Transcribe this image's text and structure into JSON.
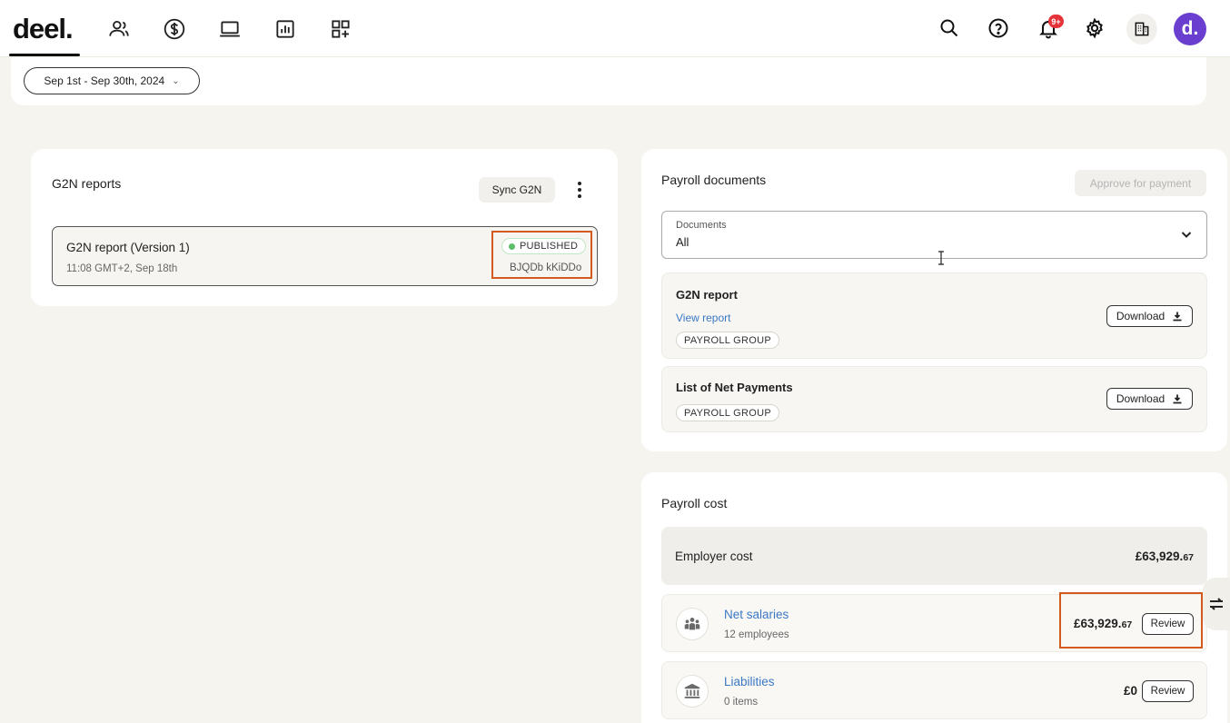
{
  "topbar": {
    "logo": "deel.",
    "nav_icons": [
      "people-icon",
      "dollar-icon",
      "laptop-icon",
      "chart-icon",
      "apps-add-icon"
    ],
    "notification_count": "9+",
    "avatar_initial": "d."
  },
  "filter": {
    "date_range": "Sep 1st - Sep 30th, 2024"
  },
  "g2n": {
    "title": "G2N reports",
    "sync_label": "Sync G2N",
    "report": {
      "name": "G2N report (Version 1)",
      "time": "11:08 GMT+2, Sep 18th",
      "status": "PUBLISHED",
      "author": "BJQDb kKiDDo"
    }
  },
  "documents": {
    "title": "Payroll documents",
    "approve_label": "Approve for payment",
    "select_label": "Documents",
    "select_value": "All",
    "items": [
      {
        "title": "G2N report",
        "link": "View report",
        "tag": "PAYROLL GROUP",
        "action": "Download"
      },
      {
        "title": "List of Net Payments",
        "tag": "PAYROLL GROUP",
        "action": "Download"
      }
    ]
  },
  "cost": {
    "title": "Payroll cost",
    "employer": {
      "label": "Employer cost",
      "amount_main": "£63,929.",
      "amount_cents": "67"
    },
    "rows": [
      {
        "name": "Net salaries",
        "sub": "12 employees",
        "amount_main": "£63,929.",
        "amount_cents": "67",
        "action": "Review"
      },
      {
        "name": "Liabilities",
        "sub": "0 items",
        "amount_main": "£0",
        "amount_cents": "",
        "action": "Review"
      }
    ]
  },
  "colors": {
    "accent_purple": "#6a3ecf",
    "link_blue": "#3b78c4",
    "highlight_orange": "#d25a1e",
    "published_green": "#5cbd6b",
    "badge_red": "#e5333a"
  }
}
